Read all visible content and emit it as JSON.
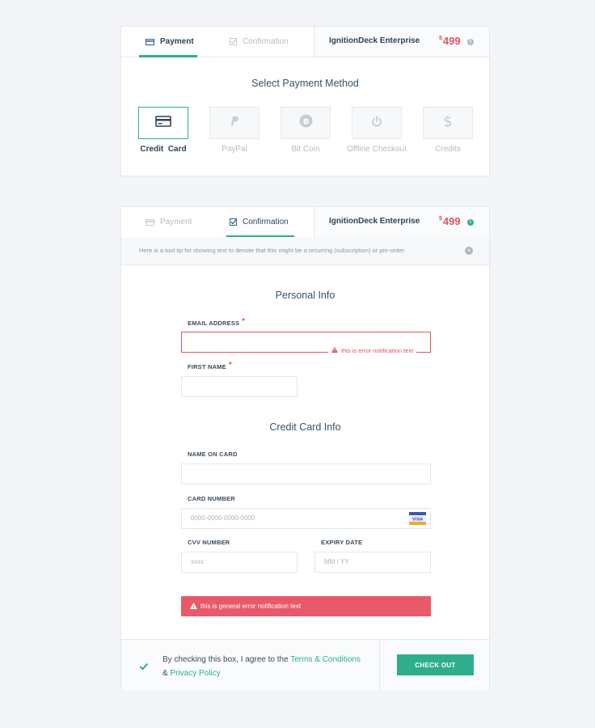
{
  "card1": {
    "tabs": [
      {
        "label": "Payment",
        "icon": "card-icon",
        "active": true
      },
      {
        "label": "Confirmation",
        "icon": "check-box-icon",
        "active": false
      }
    ],
    "product": {
      "name": "IgnitionDeck Enterprise",
      "currency": "$",
      "price": "499"
    },
    "title": "Select Payment Method",
    "methods": [
      {
        "label": "Credit  Card",
        "icon": "credit-card-icon",
        "selected": true
      },
      {
        "label": "PayPal",
        "icon": "paypal-icon",
        "selected": false
      },
      {
        "label": "Bit Coin",
        "icon": "bitcoin-icon",
        "selected": false
      },
      {
        "label": "Offline Checkout",
        "icon": "power-icon",
        "selected": false
      },
      {
        "label": "Credits",
        "icon": "dollar-icon",
        "selected": false
      }
    ]
  },
  "card2": {
    "tabs": [
      {
        "label": "Payment",
        "icon": "card-icon",
        "active": false
      },
      {
        "label": "Confirmation",
        "icon": "check-box-icon",
        "active": true
      }
    ],
    "product": {
      "name": "IgnitionDeck Enterprise",
      "currency": "$",
      "price": "499"
    },
    "tooltip": "Here is a tool tip for showing text to denote that this might be a recurring (subscription) or pre-order.",
    "personal_title": "Personal Info",
    "email_label": "EMAIL ADDRESS",
    "required_mark": "*",
    "email_error": "this is error notification text",
    "first_name_label": "FIRST NAME",
    "card_title": "Credit Card Info",
    "name_on_card_label": "NAME ON CARD",
    "card_number_label": "CARD NUMBER",
    "card_number_placeholder": "0000-0000-0000-0000",
    "card_brand": "VISA",
    "cvv_label": "CVV NUMBER",
    "cvv_placeholder": "xxxx",
    "expiry_label": "EXPIRY DATE",
    "expiry_placeholder": "MM / YY",
    "general_error": "this is general error notification text",
    "agree_prefix": "By checking this box, I agree to the ",
    "terms_link": "Terms & Conditions",
    "agree_and": "& ",
    "privacy_link": "Privacy Policy",
    "checkout_label": "CHECK OUT"
  },
  "colors": {
    "accent": "#2eae8c",
    "error": "#e3525f",
    "error_bg": "#e85a69",
    "text": "#2f4356"
  }
}
